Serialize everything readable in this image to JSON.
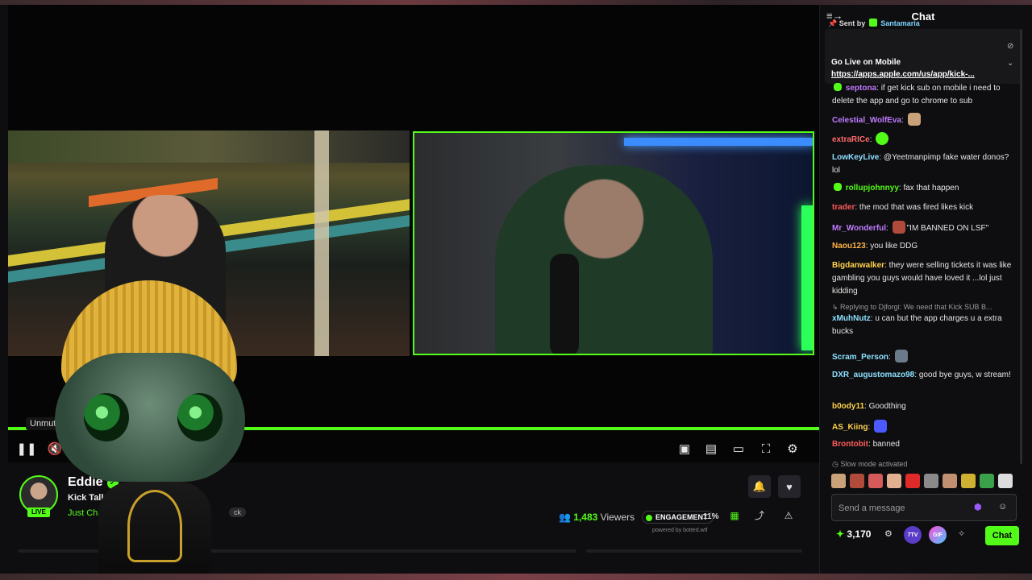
{
  "player": {
    "tooltip": "Unmute (m)",
    "icons": {
      "pause": "pause-icon",
      "mute": "muted-speaker-icon",
      "pip": "picture-in-picture-icon",
      "theater": "theater-mode-icon",
      "miniplayer": "mini-player-icon",
      "fullscreen": "fullscreen-icon",
      "settings": "gear-icon"
    },
    "progress_color": "#53fc18"
  },
  "stream": {
    "channel": "Eddie",
    "title": "Kick Talk Epis",
    "category": "Just Chatti",
    "tag": "ck",
    "live_badge": "LIVE",
    "viewers_count": "1,483",
    "viewers_label": "Viewers",
    "engagement_label": "ENGAGEMENT",
    "engagement_pct": "11%",
    "powered_by": "powered by botted.wtf"
  },
  "chat": {
    "header": "Chat",
    "pinned": {
      "sent_by_label": "Sent by",
      "sent_by_user": "Santamaria",
      "title": "Go Live on Mobile",
      "link": "https://apps.apple.com/us/app/kick-..."
    },
    "messages": [
      {
        "user": "septona",
        "color": "#c07bff",
        "text": "if get kick sub on mobile i need to delete the app and go to chrome to sub"
      },
      {
        "user": "Celestial_WolfEva",
        "color": "#c07bff",
        "text": ""
      },
      {
        "user": "extraRICe",
        "color": "#ff6b6b",
        "text": ""
      },
      {
        "user": "LowKeyLive",
        "color": "#8be0ff",
        "text": "@Yeetmanpimp  fake water donos? lol"
      },
      {
        "user": "rollupjohnnyy",
        "color": "#53fc18",
        "text": "fax that happen"
      },
      {
        "user": "trader",
        "color": "#ff5a5a",
        "text": "the mod that was fired likes kick"
      },
      {
        "user": "Mr_Wonderful",
        "color": "#c07bff",
        "text": "\"IM BANNED ON LSF\""
      },
      {
        "user": "Naou123",
        "color": "#ffb347",
        "text": "you like DDG"
      },
      {
        "user": "Bigdanwalker",
        "color": "#ffd24a",
        "text": "they were selling tickets it was like gambling you guys would have loved it ...lol just kidding"
      },
      {
        "user": "xMuhNutz",
        "color": "#8be0ff",
        "text": "u can but the app charges u a extra  bucks"
      },
      {
        "user": "Scram_Person",
        "color": "#8be0ff",
        "text": ""
      },
      {
        "user": "DXR_augustomazo98",
        "color": "#8be0ff",
        "text": "good bye guys, w stream!"
      },
      {
        "user": "b0ody11",
        "color": "#ffd24a",
        "text": "Goodthing"
      },
      {
        "user": "AS_Kiing",
        "color": "#ffd24a",
        "text": ""
      },
      {
        "user": "Brontobit",
        "color": "#ff5a5a",
        "text": "banned"
      }
    ],
    "reply_note": "Replying to Djforgi: We need that Kick SUB B...",
    "slow_mode": "Slow mode activated",
    "input_placeholder": "Send a message",
    "points": "3,170",
    "pill_7tv": "7TV",
    "pill_gif": "GIF",
    "send_label": "Chat"
  }
}
